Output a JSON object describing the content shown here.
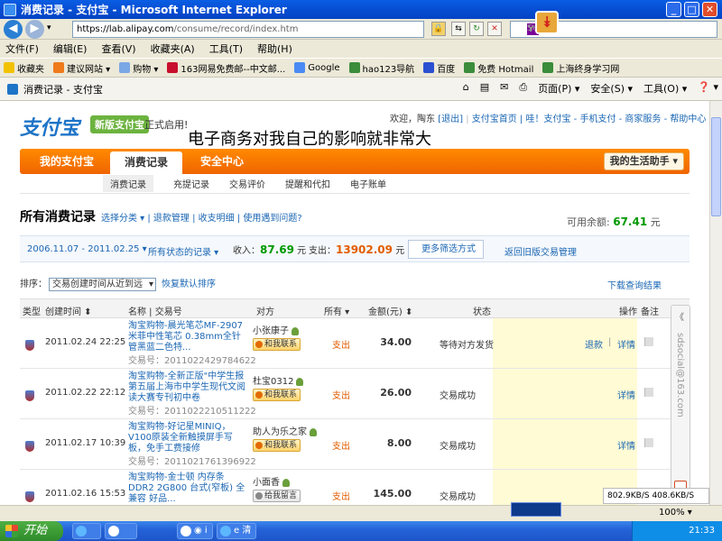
{
  "window": {
    "title": "消费记录 - 支付宝 - Microsoft Internet Explorer",
    "min": "_",
    "max": "□",
    "close": "✕"
  },
  "address": {
    "url_domain": "https://lab.alipay.com",
    "url_path": "/consume/record/index.htm",
    "search_placeholder": "Search"
  },
  "menu": [
    "文件(F)",
    "编辑(E)",
    "查看(V)",
    "收藏夹(A)",
    "工具(T)",
    "帮助(H)"
  ],
  "favorites": [
    {
      "label": "收藏夹",
      "color": "#f2c200"
    },
    {
      "label": "建议网站 ▾",
      "color": "#ef7a1a"
    },
    {
      "label": "购物 ▾",
      "color": "#7aa7e6"
    },
    {
      "label": "163网易免费邮--中文邮...",
      "color": "#c8102e"
    },
    {
      "label": "Google",
      "color": "#4a8af4"
    },
    {
      "label": "hao123导航",
      "color": "#3b8c3b"
    },
    {
      "label": "百度",
      "color": "#2b4fd1"
    },
    {
      "label": "免费 Hotmail",
      "color": "#3b8c3b"
    },
    {
      "label": "上海终身学习网",
      "color": "#3b8c3b"
    }
  ],
  "tab": {
    "label": "消费记录 - 支付宝"
  },
  "tab_tools": [
    "▾",
    "页面(P) ▾",
    "安全(S) ▾",
    "工具(O) ▾",
    "❓ ▾"
  ],
  "site": {
    "logo": "支付宝",
    "badge": "新版支付宝",
    "badge_tail": "正式启用!",
    "welcome": "欢迎，陶东",
    "logout": "[退出]",
    "links": "支付宝首页 | 哇！支付宝 - 手机支付 - 商家服务 - 帮助中心",
    "overlay": "电子商务对我自己的影响就非常大",
    "nav": {
      "my": "我的支付宝",
      "records": "消费记录",
      "security": "安全中心",
      "life": "我的生活助手 ▾"
    },
    "subnav": [
      "消费记录",
      "充提记录",
      "交易评价",
      "提醒和代扣",
      "电子账单"
    ],
    "heading": "所有消费记录",
    "heading_links": "选择分类 ▾  |  退款管理  |  收支明细  |  使用遇到问题?",
    "balance_label": "可用余额:",
    "balance_value": "67.41",
    "balance_unit": "元",
    "filter": {
      "range": "2006.11.07 - 2011.02.25 ▾",
      "status": "所有状态的记录 ▾",
      "income_label": "收入：",
      "income": "87.69",
      "income_unit": "元",
      "expense_label": "支出：",
      "expense": "13902.09",
      "expense_unit": "元",
      "more": "更多筛选方式",
      "old": "返回旧版交易管理"
    },
    "sort_label": "排序：",
    "sort_value": "交易创建时间从近到远",
    "sort_reset": "恢复默认排序",
    "download": "下载查询结果",
    "columns": [
      "类型",
      "创建时间 ⬍",
      "名称 | 交易号",
      "对方",
      "所有 ▾",
      "金额(元) ⬍",
      "状态",
      "操作",
      "备注"
    ],
    "rows": [
      {
        "time": "2011.02.24 22:25",
        "name": "淘宝购物-晨光笔芯MF-2907米菲中性笔芯 0.38mm全针管黑蓝二色特...",
        "txno": "交易号：2011022429784622",
        "party": "小张康子",
        "contact": "和我联系",
        "dir": "支出",
        "amount": "34.00",
        "status": "等待对方发货",
        "op1": "退款",
        "sep": "|",
        "op2": "详情"
      },
      {
        "time": "2011.02.22 22:12",
        "name": "淘宝购物-全新正版\"中学生报第五届上海市中学生现代文阅读大赛专刊初中卷",
        "txno": "交易号：2011022210511222",
        "party": "杜宝0312",
        "contact": "和我联系",
        "dir": "支出",
        "amount": "26.00",
        "status": "交易成功",
        "op1": "",
        "sep": "",
        "op2": "详情"
      },
      {
        "time": "2011.02.17 10:39",
        "name": "淘宝购物-好记星MINIQ，V100原装全新触摸屏手写板，免手工费接修",
        "txno": "交易号：2011021761396922",
        "party": "助人为乐之家",
        "contact": "和我联系",
        "dir": "支出",
        "amount": "8.00",
        "status": "交易成功",
        "op1": "",
        "sep": "",
        "op2": "详情"
      },
      {
        "time": "2011.02.16 15:53",
        "name": "淘宝购物-金士顿 内存条 DDR2 2G800 台式(窄板) 全兼容 好品...",
        "txno": "",
        "party": "小面香",
        "contact": "给我留言",
        "dir": "支出",
        "amount": "145.00",
        "status": "交易成功",
        "op1": "",
        "sep": "",
        "op2": "详情"
      }
    ],
    "side_text": "sdsocial@163.com",
    "side_top": "《"
  },
  "statusbar": {
    "speed": "802.9KB/S  408.6KB/S",
    "zoom": "100% ▾"
  },
  "taskbar": {
    "start": "开始",
    "tasks": [
      "e",
      "◉ i",
      "e 清"
    ],
    "clock": "21:33"
  }
}
